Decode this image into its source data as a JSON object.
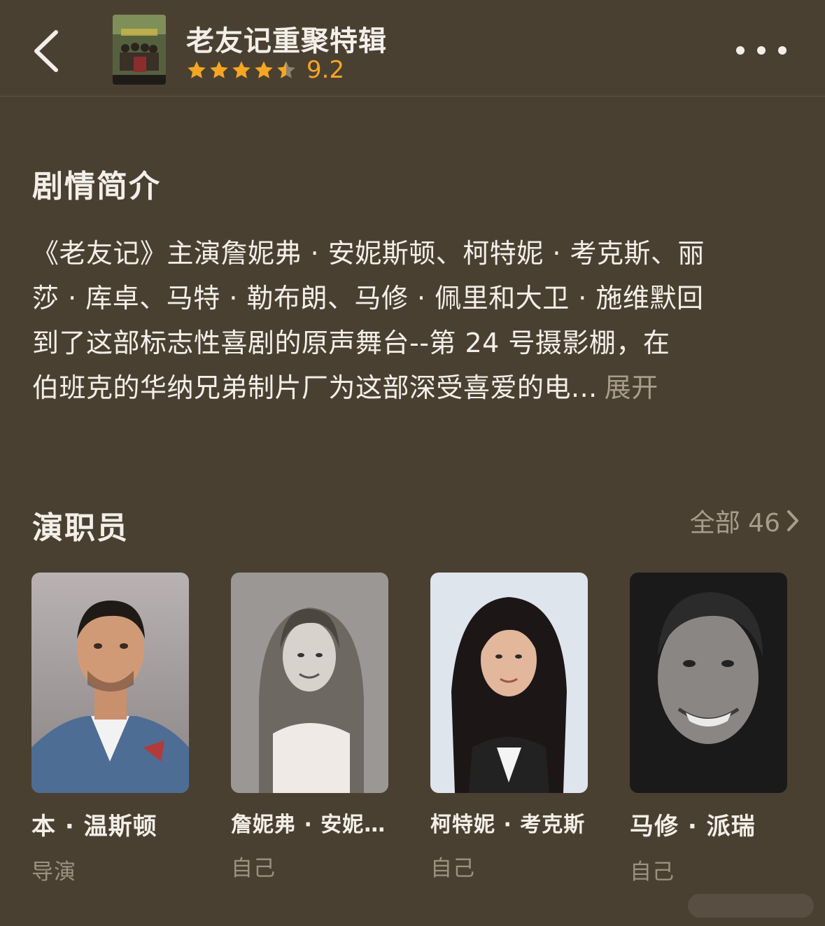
{
  "header": {
    "title": "老友记重聚特辑",
    "rating": "9.2",
    "rating_stars": 4.5,
    "accent_color": "#f6a623"
  },
  "synopsis": {
    "heading": "剧情简介",
    "lines": [
      "《老友记》主演詹妮弗 · 安妮斯顿、柯特妮 · 考克斯、丽",
      "莎 · 库卓、马特 · 勒布朗、马修 · 佩里和大卫 · 施维默回",
      "到了这部标志性喜剧的原声舞台--第 24 号摄影棚，在",
      "伯班克的华纳兄弟制片厂为这部深受喜爱的电..."
    ],
    "expand_label": "展开"
  },
  "cast": {
    "heading": "演职员",
    "all_label": "全部 46",
    "members": [
      {
        "name": "本 · 温斯顿",
        "role": "导演"
      },
      {
        "name": "詹妮弗 · 安妮...",
        "role": "自己"
      },
      {
        "name": "柯特妮 · 考克斯",
        "role": "自己"
      },
      {
        "name": "马修 · 派瑞",
        "role": "自己"
      }
    ]
  }
}
